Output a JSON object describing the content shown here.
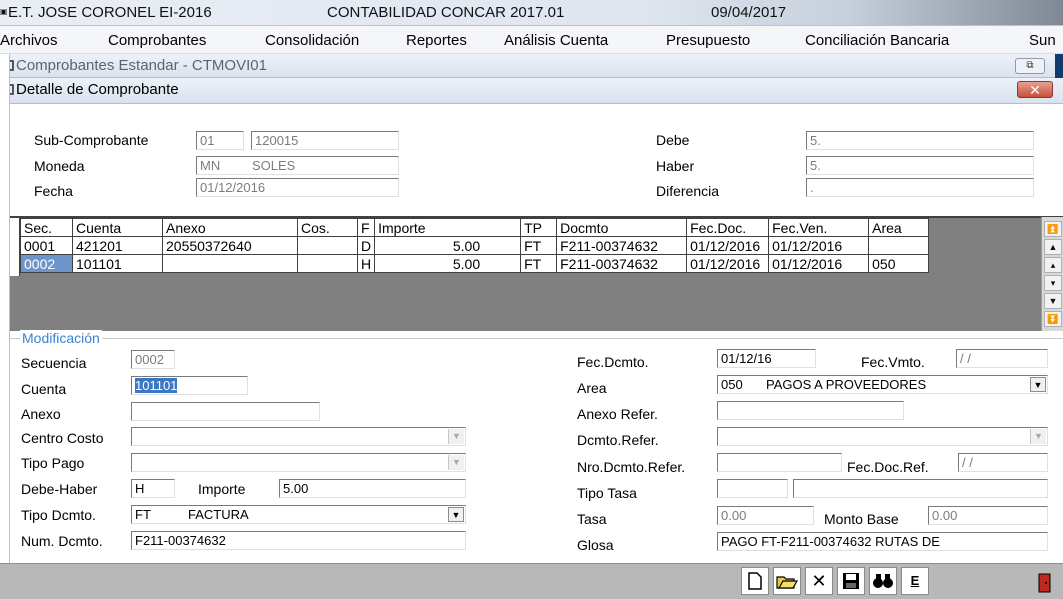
{
  "titlebar": {
    "company": "E.T. JOSE CORONEL EI-2016",
    "app": "CONTABILIDAD CONCAR 2017.01",
    "date": "09/04/2017"
  },
  "menu": [
    "Archivos",
    "Comprobantes",
    "Consolidación",
    "Reportes",
    "Análisis Cuenta",
    "Presupuesto",
    "Conciliación Bancaria",
    "Sun"
  ],
  "win_comprobantes": {
    "title": "Comprobantes Estandar - CTMOVI01",
    "min_label": "⧉"
  },
  "win_detalle": {
    "title": "Detalle de Comprobante",
    "close_label": "✕"
  },
  "header": {
    "subcomp_label": "Sub-Comprobante",
    "subcomp_code": "01",
    "subcomp_num": "120015",
    "moneda_label": "Moneda",
    "moneda_code": "MN",
    "moneda_name": "SOLES",
    "fecha_label": "Fecha",
    "fecha_value": "01/12/2016",
    "debe_label": "Debe",
    "debe_value": "5.",
    "haber_label": "Haber",
    "haber_value": "5.",
    "diferencia_label": "Diferencia",
    "diferencia_value": "."
  },
  "grid": {
    "columns": [
      "Sec.",
      "Cuenta",
      "Anexo",
      "Cos.",
      "F",
      "Importe",
      "TP",
      "Docmto",
      "Fec.Doc.",
      "Fec.Ven.",
      "Area"
    ],
    "rows": [
      [
        "0001",
        "421201",
        "20550372640",
        "",
        "D",
        "5.00",
        "FT",
        "F211-00374632",
        "01/12/2016",
        "01/12/2016",
        ""
      ],
      [
        "0002",
        "101101",
        "",
        "",
        "H",
        "5.00",
        "FT",
        "F211-00374632",
        "01/12/2016",
        "01/12/2016",
        "050"
      ]
    ]
  },
  "mod": {
    "legend": "Modificación",
    "secuencia_label": "Secuencia",
    "secuencia_value": "0002",
    "cuenta_label": "Cuenta",
    "cuenta_value": "101101",
    "anexo_label": "Anexo",
    "anexo_value": "",
    "centro_label": "Centro Costo",
    "centro_value": "",
    "tipopago_label": "Tipo Pago",
    "tipopago_value": "",
    "debehaber_label": "Debe-Haber",
    "debehaber_value": "H",
    "importe_label": "Importe",
    "importe_value": "5.00",
    "tipodcmto_label": "Tipo Dcmto.",
    "tipodcmto_code": "FT",
    "tipodcmto_name": "FACTURA",
    "numdcmto_label": "Num. Dcmto.",
    "numdcmto_value": "F211-00374632",
    "fecdcmto_label": "Fec.Dcmto.",
    "fecdcmto_value": "01/12/16",
    "fecvmto_label": "Fec.Vmto.",
    "fecvmto_value": " / /",
    "area_label": "Area",
    "area_code": "050",
    "area_name": "PAGOS A PROVEEDORES",
    "anexoref_label": "Anexo Refer.",
    "anexoref_value": "",
    "dcmtoref_label": "Dcmto.Refer.",
    "dcmtoref_value": "",
    "nrodcmtoref_label": "Nro.Dcmto.Refer.",
    "nrodcmtoref_value": "",
    "fecdocref_label": "Fec.Doc.Ref.",
    "fecdocref_value": " / /",
    "tipotasa_label": "Tipo Tasa",
    "tipotasa_value": "",
    "tipotasa_desc": "",
    "tasa_label": "Tasa",
    "tasa_value": "0.00",
    "montobase_label": "Monto Base",
    "montobase_value": "0.00",
    "glosa_label": "Glosa",
    "glosa_value": "PAGO FT-F211-00374632 RUTAS DE"
  },
  "toolbar": {
    "new_icon": "new-document-icon",
    "open_icon": "open-folder-icon",
    "delete_icon": "delete-x-icon",
    "save_icon": "save-disk-icon",
    "find_icon": "binoculars-icon",
    "e_label": "E",
    "exit_icon": "exit-door-icon"
  }
}
